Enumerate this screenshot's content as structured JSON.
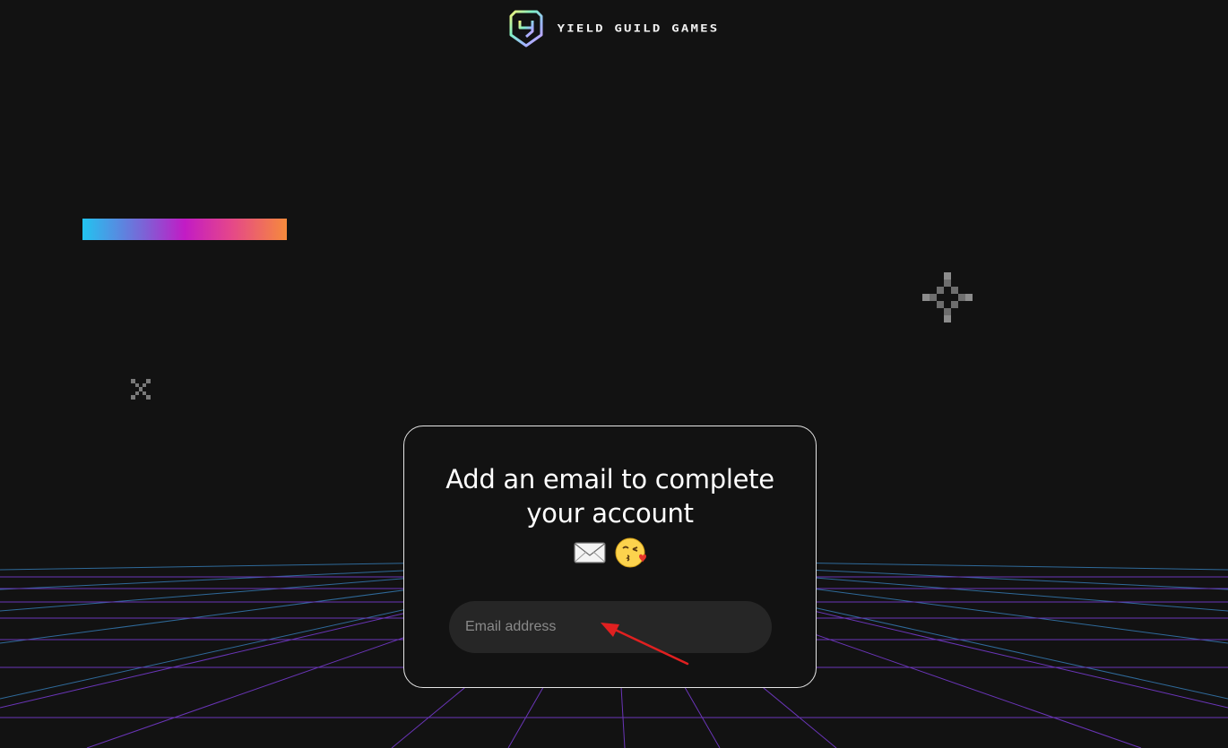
{
  "header": {
    "brand_name": "YIELD GUILD GAMES",
    "logo_icon": "ygg-shield-logo-icon"
  },
  "decorations": {
    "gradient_bar_colors": [
      "#22c4f0",
      "#7c63d6",
      "#c21bc5",
      "#e4458c",
      "#f68a3c"
    ],
    "pixel_cross_icon": "pixel-crosshair-icon",
    "pixel_x_icon": "pixel-x-icon",
    "grid_floor_colors": [
      "#2f6a9a",
      "#6a35b8"
    ]
  },
  "card": {
    "title_line1": "Add an email to complete",
    "title_line2": "your account",
    "emojis": [
      "envelope-emoji",
      "face-blowing-kiss-emoji"
    ],
    "email_input": {
      "placeholder": "Email address",
      "value": ""
    }
  },
  "annotation": {
    "arrow_color": "#e02020"
  },
  "colors": {
    "background": "#121212",
    "card_border": "#e6e6e6",
    "input_background": "#262626",
    "text": "#ffffff"
  }
}
